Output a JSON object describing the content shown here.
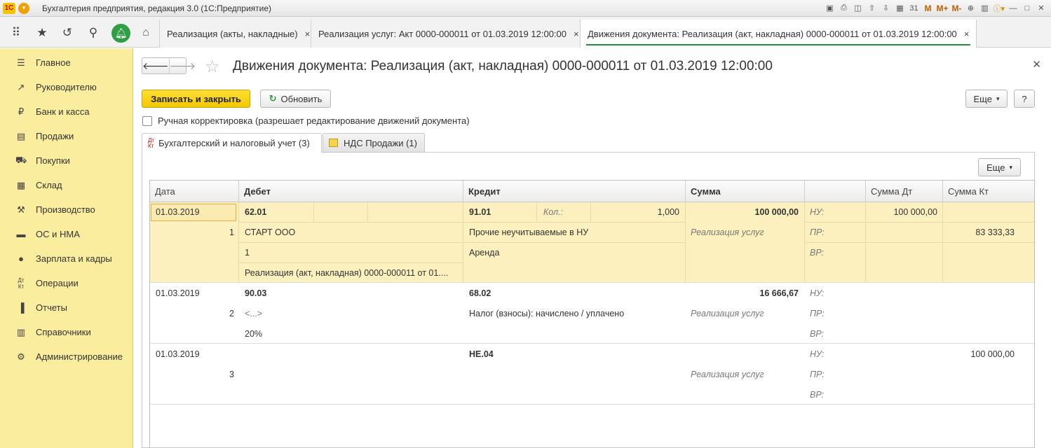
{
  "app": {
    "title": "Бухгалтерия предприятия, редакция 3.0  (1С:Предприятие)",
    "logo": "1С",
    "toolbar_m": "M",
    "toolbar_mplus": "M+",
    "toolbar_mminus": "M-"
  },
  "tabs": [
    {
      "label": "Реализация (акты, накладные)",
      "close": "×"
    },
    {
      "label": "Реализация услуг: Акт 0000-000011 от 01.03.2019 12:00:00",
      "close": "×"
    },
    {
      "label": "Движения документа: Реализация (акт, накладная) 0000-000011 от 01.03.2019 12:00:00",
      "close": "×"
    }
  ],
  "sidebar": {
    "items": [
      {
        "label": "Главное",
        "icon": "menu-icon"
      },
      {
        "label": "Руководителю",
        "icon": "chart-line-icon"
      },
      {
        "label": "Банк и касса",
        "icon": "ruble-icon"
      },
      {
        "label": "Продажи",
        "icon": "sales-icon"
      },
      {
        "label": "Покупки",
        "icon": "cart-icon"
      },
      {
        "label": "Склад",
        "icon": "warehouse-icon"
      },
      {
        "label": "Производство",
        "icon": "production-icon"
      },
      {
        "label": "ОС и НМА",
        "icon": "truck-icon"
      },
      {
        "label": "Зарплата и кадры",
        "icon": "person-icon"
      },
      {
        "label": "Операции",
        "icon": "dt-kt-icon"
      },
      {
        "label": "Отчеты",
        "icon": "bar-chart-icon"
      },
      {
        "label": "Справочники",
        "icon": "book-icon"
      },
      {
        "label": "Администрирование",
        "icon": "gear-icon"
      }
    ]
  },
  "document": {
    "title": "Движения документа: Реализация (акт, накладная) 0000-000011 от 01.03.2019 12:00:00",
    "save_close": "Записать и закрыть",
    "refresh": "Обновить",
    "more": "Еще",
    "help": "?",
    "manual_correction": "Ручная корректировка (разрешает редактирование движений документа)",
    "panel_tabs": [
      {
        "label": "Бухгалтерский и налоговый учет (3)",
        "icon_top": "Дт",
        "icon_bottom": "Кт"
      },
      {
        "label": "НДС Продажи (1)"
      }
    ],
    "grid_more": "Еще"
  },
  "grid": {
    "headers": {
      "date": "Дата",
      "debit": "Дебет",
      "credit": "Кредит",
      "sum": "Сумма",
      "sum_dt": "Сумма Дт",
      "sum_kt": "Сумма Кт"
    },
    "rows": [
      {
        "date": "01.03.2019",
        "num": "1",
        "debit_account": "62.01",
        "debit_sub1": "СТАРТ ООО",
        "debit_sub2": "1",
        "debit_sub3": "Реализация (акт, накладная) 0000-000011 от 01....",
        "credit_account": "91.01",
        "credit_qty_label": "Кол.:",
        "credit_qty": "1,000",
        "credit_sub1": "Прочие неучитываемые в НУ",
        "credit_sub2": "Аренда",
        "sum": "100 000,00",
        "content": "Реализация услуг",
        "nu": "НУ:",
        "pr": "ПР:",
        "vr": "ВР:",
        "nu_dt": "100 000,00",
        "pr_dt": "",
        "vr_dt": "",
        "nu_kt": "",
        "pr_kt": "83 333,33",
        "vr_kt": ""
      },
      {
        "date": "01.03.2019",
        "num": "2",
        "debit_account": "90.03",
        "debit_sub1": "<...>",
        "debit_sub2": "20%",
        "debit_sub3": "",
        "credit_account": "68.02",
        "credit_sub1": "Налог (взносы): начислено / уплачено",
        "credit_sub2": "",
        "sum": "16 666,67",
        "content": "Реализация услуг",
        "nu": "НУ:",
        "pr": "ПР:",
        "vr": "ВР:",
        "nu_dt": "",
        "pr_dt": "",
        "vr_dt": "",
        "nu_kt": "",
        "pr_kt": "",
        "vr_kt": ""
      },
      {
        "date": "01.03.2019",
        "num": "3",
        "debit_account": "",
        "debit_sub1": "",
        "debit_sub2": "",
        "debit_sub3": "",
        "credit_account": "НЕ.04",
        "credit_sub1": "",
        "credit_sub2": "",
        "sum": "",
        "content": "Реализация услуг",
        "nu": "НУ:",
        "pr": "ПР:",
        "vr": "ВР:",
        "nu_dt": "",
        "pr_dt": "",
        "vr_dt": "",
        "nu_kt": "100 000,00",
        "pr_kt": "",
        "vr_kt": ""
      }
    ]
  },
  "colors": {
    "sidebar_bg": "#fbed9e",
    "primary_button": "#f2c800",
    "selected_row": "#fcf0bf",
    "bell": "#2f9e44"
  }
}
